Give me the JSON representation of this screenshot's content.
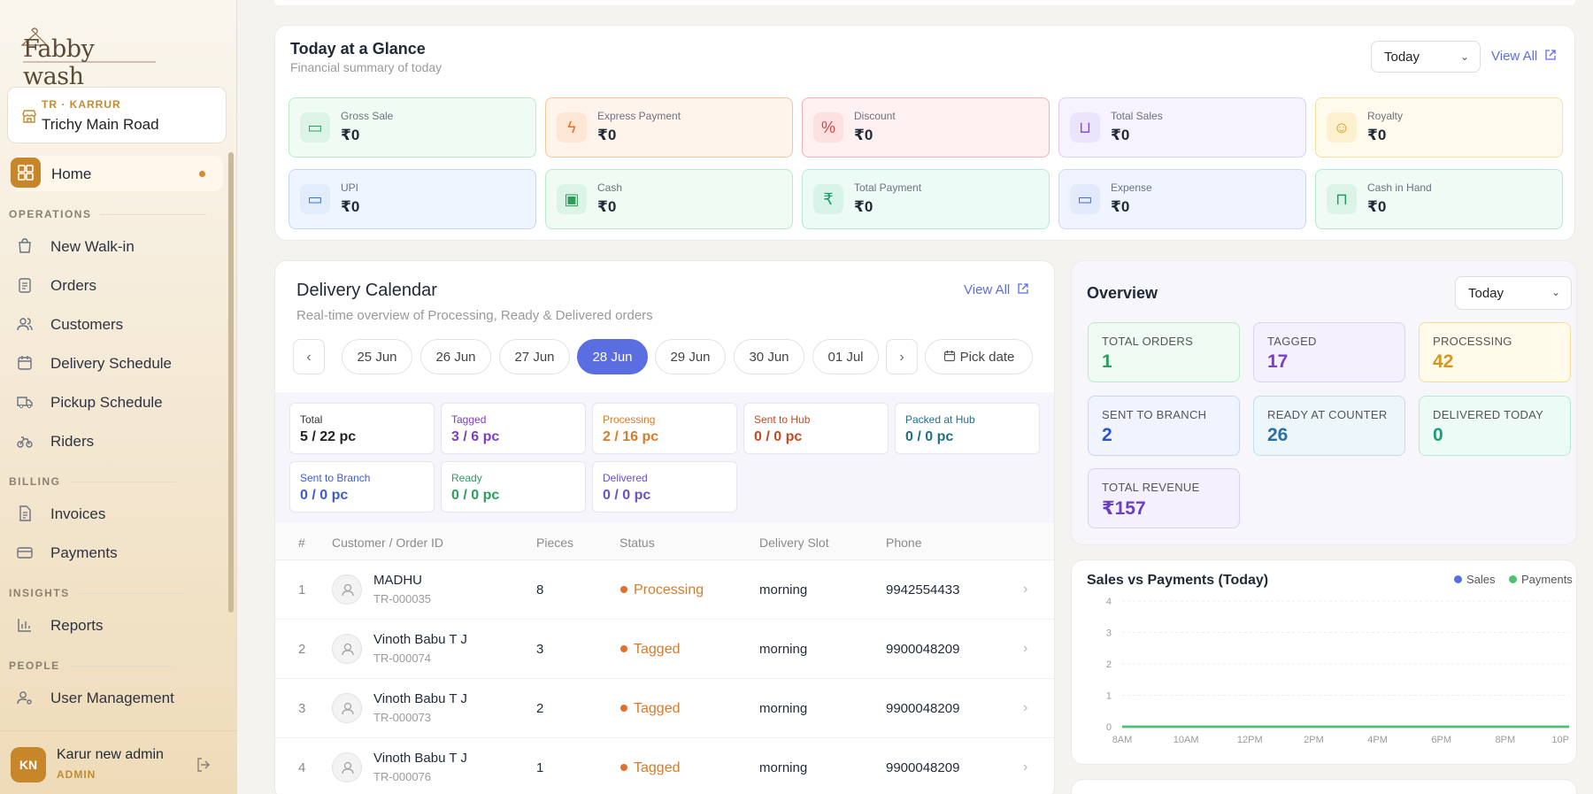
{
  "brand": {
    "logo_text": "Fabby wash"
  },
  "branch": {
    "code": "TR · KARRUR",
    "name": "Trichy Main Road"
  },
  "nav": {
    "home": "Home",
    "sections": [
      {
        "title": "OPERATIONS",
        "items": [
          "New Walk-in",
          "Orders",
          "Customers",
          "Delivery Schedule",
          "Pickup Schedule",
          "Riders"
        ]
      },
      {
        "title": "BILLING",
        "items": [
          "Invoices",
          "Payments"
        ]
      },
      {
        "title": "INSIGHTS",
        "items": [
          "Reports"
        ]
      },
      {
        "title": "PEOPLE",
        "items": [
          "User Management"
        ]
      }
    ]
  },
  "user": {
    "initials": "KN",
    "name": "Karur new admin",
    "role": "ADMIN"
  },
  "glance": {
    "title": "Today at a Glance",
    "subtitle": "Financial summary of today",
    "period": "Today",
    "view_all": "View All",
    "tiles": [
      {
        "label": "Gross Sale",
        "value": "₹0"
      },
      {
        "label": "Express Payment",
        "value": "₹0"
      },
      {
        "label": "Discount",
        "value": "₹0"
      },
      {
        "label": "Total Sales",
        "value": "₹0"
      },
      {
        "label": "Royalty",
        "value": "₹0"
      },
      {
        "label": "UPI",
        "value": "₹0"
      },
      {
        "label": "Cash",
        "value": "₹0"
      },
      {
        "label": "Total Payment",
        "value": "₹0"
      },
      {
        "label": "Expense",
        "value": "₹0"
      },
      {
        "label": "Cash in Hand",
        "value": "₹0"
      }
    ]
  },
  "calendar": {
    "title": "Delivery Calendar",
    "subtitle": "Real-time overview of Processing, Ready & Delivered orders",
    "view_all": "View All",
    "dates": [
      "25 Jun",
      "26 Jun",
      "27 Jun",
      "28 Jun",
      "29 Jun",
      "30 Jun",
      "01 Jul"
    ],
    "active_date": "28 Jun",
    "pick_date": "Pick date",
    "stats": [
      {
        "label": "Total",
        "value": "5 / 22 pc"
      },
      {
        "label": "Tagged",
        "value": "3 / 6 pc"
      },
      {
        "label": "Processing",
        "value": "2 / 16 pc"
      },
      {
        "label": "Sent to Hub",
        "value": "0 / 0 pc"
      },
      {
        "label": "Packed at Hub",
        "value": "0 / 0 pc"
      },
      {
        "label": "Sent to Branch",
        "value": "0 / 0 pc"
      },
      {
        "label": "Ready",
        "value": "0 / 0 pc"
      },
      {
        "label": "Delivered",
        "value": "0 / 0 pc"
      }
    ],
    "columns": [
      "#",
      "Customer / Order ID",
      "Pieces",
      "Status",
      "Delivery Slot",
      "Phone"
    ],
    "rows": [
      {
        "num": "1",
        "name": "MADHU",
        "order_id": "TR-000035",
        "pieces": "8",
        "status": "Processing",
        "slot": "morning",
        "phone": "9942554433"
      },
      {
        "num": "2",
        "name": "Vinoth Babu T J",
        "order_id": "TR-000074",
        "pieces": "3",
        "status": "Tagged",
        "slot": "morning",
        "phone": "9900048209"
      },
      {
        "num": "3",
        "name": "Vinoth Babu T J",
        "order_id": "TR-000073",
        "pieces": "2",
        "status": "Tagged",
        "slot": "morning",
        "phone": "9900048209"
      },
      {
        "num": "4",
        "name": "Vinoth Babu T J",
        "order_id": "TR-000076",
        "pieces": "1",
        "status": "Tagged",
        "slot": "morning",
        "phone": "9900048209"
      }
    ]
  },
  "overview": {
    "title": "Overview",
    "period": "Today",
    "tiles": [
      {
        "label": "TOTAL ORDERS",
        "value": "1"
      },
      {
        "label": "TAGGED",
        "value": "17"
      },
      {
        "label": "PROCESSING",
        "value": "42"
      },
      {
        "label": "SENT TO BRANCH",
        "value": "2"
      },
      {
        "label": "READY AT COUNTER",
        "value": "26"
      },
      {
        "label": "DELIVERED TODAY",
        "value": "0"
      },
      {
        "label": "TOTAL REVENUE",
        "value": "₹157"
      }
    ]
  },
  "chart_data": {
    "type": "line",
    "title": "Sales vs Payments (Today)",
    "x": [
      "8AM",
      "10AM",
      "12PM",
      "2PM",
      "4PM",
      "6PM",
      "8PM",
      "10P"
    ],
    "yticks": [
      0,
      1,
      2,
      3,
      4
    ],
    "ylim": [
      0,
      4
    ],
    "legend_position": "top-right",
    "series": [
      {
        "name": "Sales",
        "color": "#5b6ee1",
        "values": [
          0,
          0,
          0,
          0,
          0,
          0,
          0,
          0
        ]
      },
      {
        "name": "Payments",
        "color": "#4cc36b",
        "values": [
          0,
          0,
          0,
          0,
          0,
          0,
          0,
          0
        ]
      }
    ]
  }
}
